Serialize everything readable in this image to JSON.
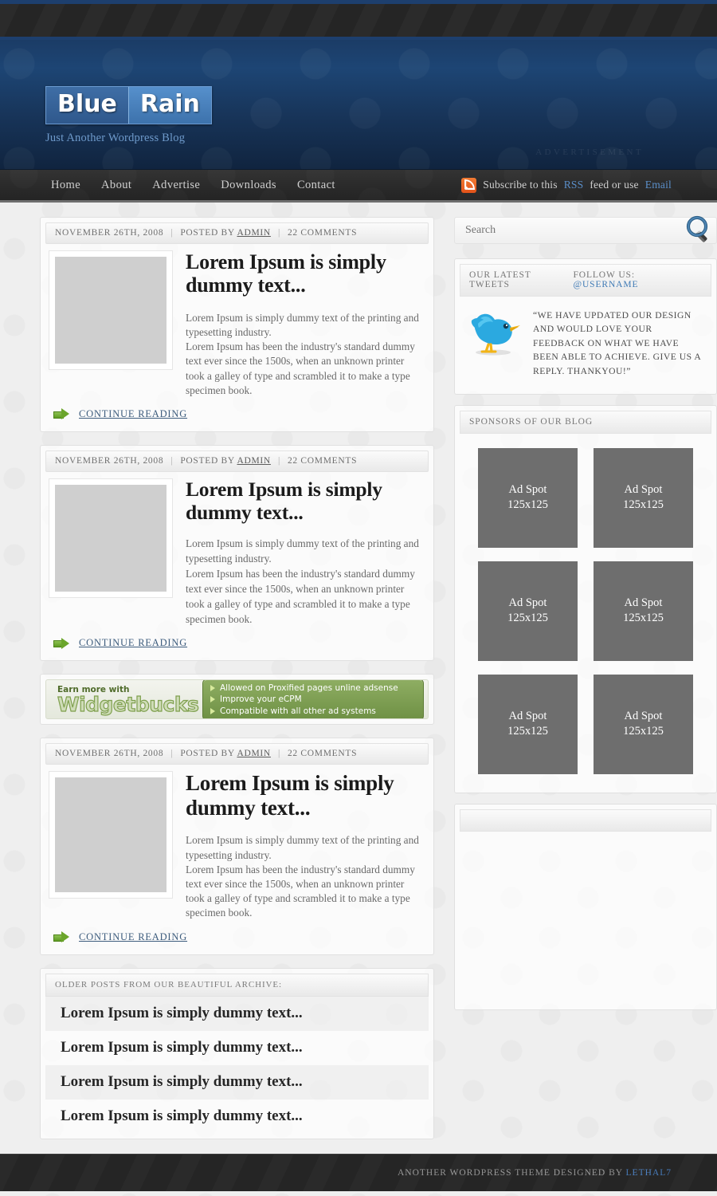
{
  "header": {
    "logo_part1": "Blue",
    "logo_part2": "Rain",
    "tagline": "Just Another Wordpress Blog",
    "advertisement_label": "ADVERTISEMENT"
  },
  "nav": {
    "items": [
      "Home",
      "About",
      "Advertise",
      "Downloads",
      "Contact"
    ],
    "rss": {
      "icon": "rss-icon",
      "text_before": "Subscribe to this ",
      "link1": "RSS",
      "text_middle": " feed or use ",
      "link2": "Email"
    }
  },
  "posts": [
    {
      "date": "NOVEMBER 26TH, 2008",
      "posted_by_label": "POSTED BY",
      "author": "ADMIN",
      "comments": "22 COMMENTS",
      "title": "Lorem Ipsum is simply dummy text...",
      "excerpt_line1": "Lorem Ipsum is simply dummy text of the printing and typesetting industry.",
      "excerpt_line2": "Lorem Ipsum has been the industry's standard dummy text ever since the 1500s, when an unknown printer took a galley of type and scrambled it to make a type specimen book.",
      "continue_label": "CONTINUE READING"
    },
    {
      "date": "NOVEMBER 26TH, 2008",
      "posted_by_label": "POSTED BY",
      "author": "ADMIN",
      "comments": "22 COMMENTS",
      "title": "Lorem Ipsum is simply dummy text...",
      "excerpt_line1": "Lorem Ipsum is simply dummy text of the printing and typesetting industry.",
      "excerpt_line2": "Lorem Ipsum has been the industry's standard dummy text ever since the 1500s, when an unknown printer took a galley of type and scrambled it to make a type specimen book.",
      "continue_label": "CONTINUE READING"
    },
    {
      "date": "NOVEMBER 26TH, 2008",
      "posted_by_label": "POSTED BY",
      "author": "ADMIN",
      "comments": "22 COMMENTS",
      "title": "Lorem Ipsum is simply dummy text...",
      "excerpt_line1": "Lorem Ipsum is simply dummy text of the printing and typesetting industry.",
      "excerpt_line2": "Lorem Ipsum has been the industry's standard dummy text ever since the 1500s, when an unknown printer took a galley of type and scrambled it to make a type specimen book.",
      "continue_label": "CONTINUE READING"
    }
  ],
  "widgetbucks": {
    "earn_more": "Earn more with",
    "brand": "Widgetbucks",
    "bullets": [
      "Allowed on Proxified pages unline adsense",
      "Improve your eCPM",
      "Compatible with all other ad systems"
    ]
  },
  "archive": {
    "heading": "OLDER POSTS FROM OUR BEAUTIFUL ARCHIVE:",
    "items": [
      "Lorem Ipsum is simply dummy text...",
      "Lorem Ipsum is simply dummy text...",
      "Lorem Ipsum is simply dummy text...",
      "Lorem Ipsum is simply dummy text..."
    ]
  },
  "sidebar": {
    "search": {
      "placeholder": "Search",
      "value": "",
      "icon": "magnifier-icon"
    },
    "tweets": {
      "heading": "OUR LATEST TWEETS",
      "follow_label": "FOLLOW US:",
      "username": "@USERNAME",
      "icon": "twitter-bird-icon",
      "text": "“WE HAVE UPDATED OUR DESIGN AND WOULD LOVE YOUR FEEDBACK ON WHAT WE HAVE BEEN ABLE TO ACHIEVE. GIVE US A REPLY. THANKYOU!”"
    },
    "sponsors": {
      "heading": "SPONSORS OF OUR BLOG",
      "ads": [
        {
          "line1": "Ad Spot",
          "line2": "125x125"
        },
        {
          "line1": "Ad Spot",
          "line2": "125x125"
        },
        {
          "line1": "Ad Spot",
          "line2": "125x125"
        },
        {
          "line1": "Ad Spot",
          "line2": "125x125"
        },
        {
          "line1": "Ad Spot",
          "line2": "125x125"
        },
        {
          "line1": "Ad Spot",
          "line2": "125x125"
        }
      ]
    },
    "empty_widget": {
      "heading": ""
    }
  },
  "footer": {
    "text_before": "ANOTHER WORDPRESS THEME DESIGNED BY ",
    "link": "LETHAL7"
  },
  "colors": {
    "header_blue": "#1d4574",
    "accent_link": "#5b8fc9",
    "green_arrow": "#6ba52b",
    "rss_orange": "#e2521a",
    "ad_grey": "#6e6e6e"
  }
}
